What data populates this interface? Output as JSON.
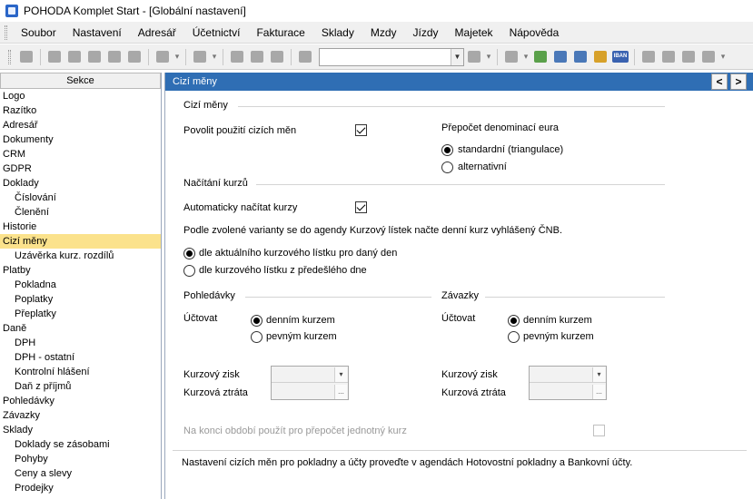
{
  "window": {
    "title": "POHODA Komplet Start - [Globální nastavení]"
  },
  "menu": [
    "Soubor",
    "Nastavení",
    "Adresář",
    "Účetnictví",
    "Fakturace",
    "Sklady",
    "Mzdy",
    "Jízdy",
    "Majetek",
    "Nápověda"
  ],
  "toolbar": {
    "iban_label": "IBAN"
  },
  "sidebar": {
    "header": "Sekce",
    "items": [
      {
        "label": "Logo",
        "level": 0
      },
      {
        "label": "Razítko",
        "level": 0
      },
      {
        "label": "Adresář",
        "level": 0
      },
      {
        "label": "Dokumenty",
        "level": 0
      },
      {
        "label": "CRM",
        "level": 0
      },
      {
        "label": "GDPR",
        "level": 0
      },
      {
        "label": "Doklady",
        "level": 0
      },
      {
        "label": "Číslování",
        "level": 1
      },
      {
        "label": "Členění",
        "level": 1
      },
      {
        "label": "Historie",
        "level": 0
      },
      {
        "label": "Cizí měny",
        "level": 0,
        "active": true
      },
      {
        "label": "Uzávěrka kurz. rozdílů",
        "level": 1
      },
      {
        "label": "Platby",
        "level": 0
      },
      {
        "label": "Pokladna",
        "level": 1
      },
      {
        "label": "Poplatky",
        "level": 1
      },
      {
        "label": "Přeplatky",
        "level": 1
      },
      {
        "label": "Daně",
        "level": 0
      },
      {
        "label": "DPH",
        "level": 1
      },
      {
        "label": "DPH - ostatní",
        "level": 1
      },
      {
        "label": "Kontrolní hlášení",
        "level": 1
      },
      {
        "label": "Daň z příjmů",
        "level": 1
      },
      {
        "label": "Pohledávky",
        "level": 0
      },
      {
        "label": "Závazky",
        "level": 0
      },
      {
        "label": "Sklady",
        "level": 0
      },
      {
        "label": "Doklady se zásobami",
        "level": 1
      },
      {
        "label": "Pohyby",
        "level": 1
      },
      {
        "label": "Ceny a slevy",
        "level": 1
      },
      {
        "label": "Prodejky",
        "level": 1
      }
    ]
  },
  "panel": {
    "title": "Cizí měny",
    "nav_prev": "<",
    "nav_next": ">",
    "group_currencies": "Cizí měny",
    "allow_foreign_label": "Povolit použití cizích měn",
    "allow_foreign_checked": true,
    "euro_title": "Přepočet denominací eura",
    "euro_standard": "standardní  (triangulace)",
    "euro_alternative": "alternativní",
    "euro_selected": "standard",
    "group_rates": "Načítání kurzů",
    "auto_rates_label": "Automaticky načítat kurzy",
    "auto_rates_checked": true,
    "rates_info": "Podle zvolené varianty se do agendy Kurzový lístek načte denní kurz vyhlášený ČNB.",
    "rates_option1": "dle aktuálního kurzového lístku pro daný den",
    "rates_option2": "dle kurzového lístku z předešlého dne",
    "rates_selected": "option1",
    "group_receivables": "Pohledávky",
    "group_payables": "Závazky",
    "account_label": "Účtovat",
    "daily_rate": "denním kurzem",
    "fixed_rate": "pevným kurzem",
    "receivables_selected": "daily",
    "payables_selected": "daily",
    "gain_label": "Kurzový zisk",
    "loss_label": "Kurzová ztráta",
    "combo_arrow": "▾",
    "combo_more": "...",
    "period_end_label": "Na konci období použít pro přepočet jednotný kurz",
    "period_end_checked": false,
    "footer_text": "Nastavení cizích měn pro pokladny a účty proveďte v agendách Hotovostní pokladny a Bankovní účty."
  }
}
